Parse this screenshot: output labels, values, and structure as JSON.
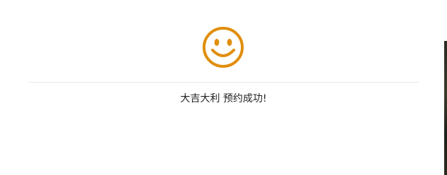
{
  "dialog": {
    "icon": "smiley-face-icon",
    "icon_color": "#E08E0B",
    "message": "大吉大利 预约成功!"
  }
}
